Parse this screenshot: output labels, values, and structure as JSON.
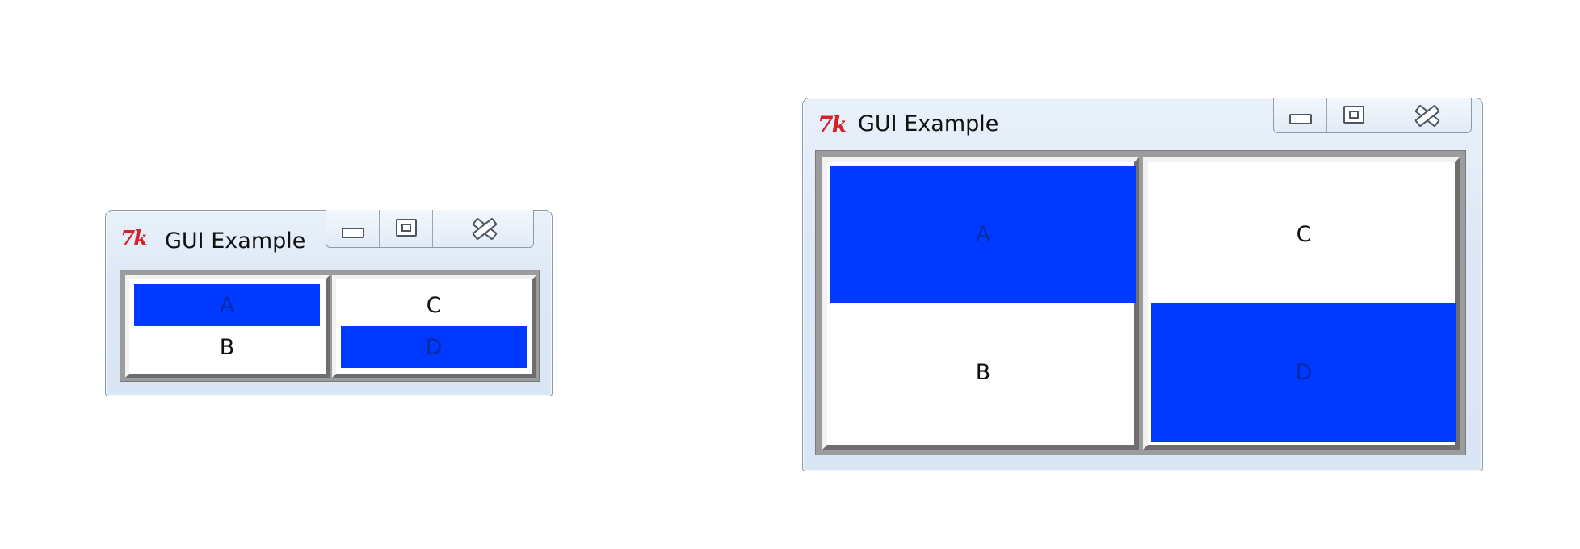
{
  "windows": [
    {
      "title": "GUI Example",
      "icon": "tk-feather-icon",
      "icon_text": "7k",
      "caption_buttons": [
        "minimize-icon",
        "maximize-icon",
        "close-icon"
      ],
      "frames": [
        {
          "cells": [
            {
              "label": "A",
              "highlighted": true
            },
            {
              "label": "B",
              "highlighted": false
            }
          ]
        },
        {
          "cells": [
            {
              "label": "C",
              "highlighted": false
            },
            {
              "label": "D",
              "highlighted": true
            }
          ]
        }
      ]
    },
    {
      "title": "GUI Example",
      "icon": "tk-feather-icon",
      "icon_text": "7k",
      "caption_buttons": [
        "minimize-icon",
        "maximize-icon",
        "close-icon"
      ],
      "frames": [
        {
          "cells": [
            {
              "label": "A",
              "highlighted": true
            },
            {
              "label": "B",
              "highlighted": false
            }
          ]
        },
        {
          "cells": [
            {
              "label": "C",
              "highlighted": false
            },
            {
              "label": "D",
              "highlighted": true
            }
          ]
        }
      ]
    }
  ],
  "colors": {
    "highlight": "#0039ff",
    "highlight_text": "#052aa6",
    "tk_icon": "#d4222a"
  }
}
